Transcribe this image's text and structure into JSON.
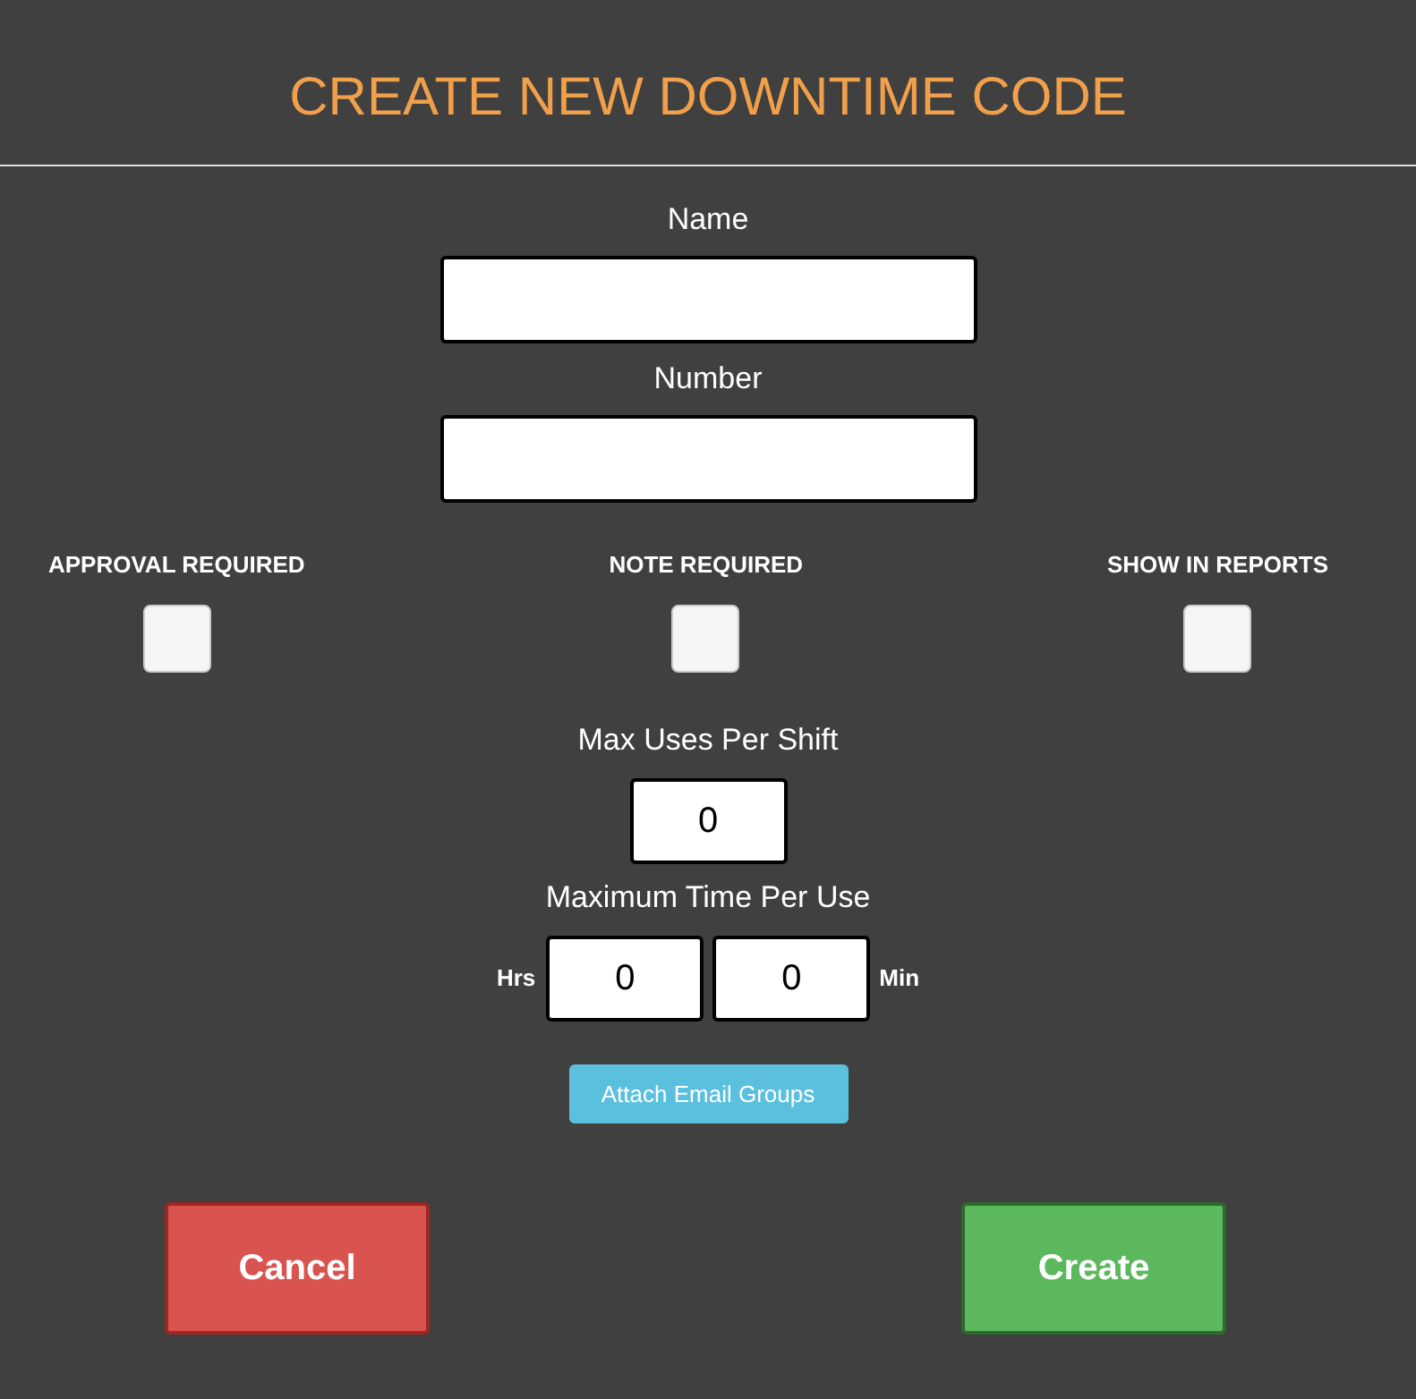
{
  "title": "CREATE NEW DOWNTIME CODE",
  "fields": [
    {
      "label": "Name"
    },
    {
      "label": "Number"
    }
  ],
  "checkboxes": [
    {
      "label": "APPROVAL REQUIRED",
      "checked": false
    },
    {
      "label": "NOTE REQUIRED",
      "checked": false
    },
    {
      "label": "SHOW IN REPORTS",
      "checked": false
    }
  ],
  "max_uses": {
    "label": "Max Uses Per Shift",
    "value": "0"
  },
  "max_time": {
    "label": "Maximum Time Per Use",
    "hours_label": "Hrs",
    "hours": "0",
    "minutes": "0",
    "minutes_label": "Min"
  },
  "attach_button": "Attach Email Groups",
  "buttons": [
    {
      "label": "Cancel",
      "kind": "cancel"
    },
    {
      "label": "Create",
      "kind": "create"
    }
  ]
}
